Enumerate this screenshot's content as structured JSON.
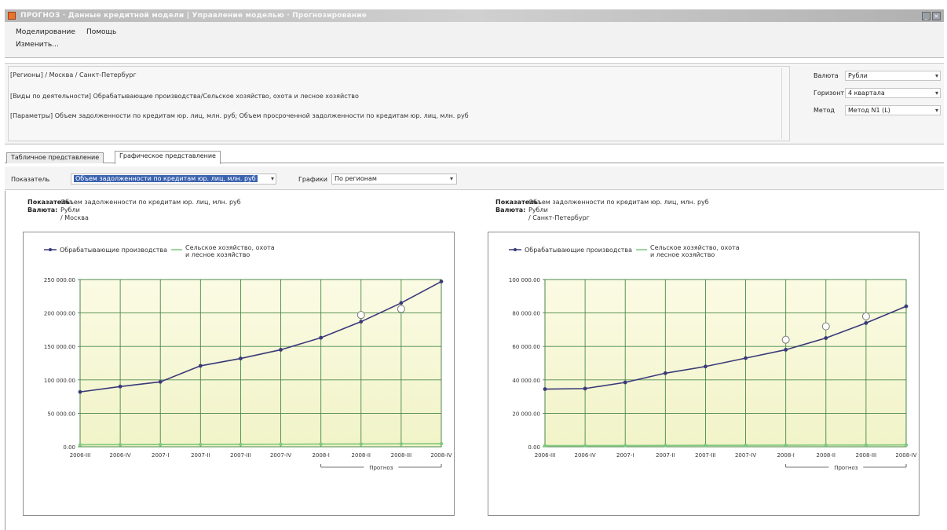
{
  "window": {
    "title": "ПРОГНОЗ · Данные кредитной модели | Управление моделью · Прогнозирование",
    "minimize_glyph": "_",
    "close_glyph": "×"
  },
  "menu": {
    "items": [
      "Моделирование",
      "Помощь"
    ],
    "toolbar_button": "Изменить..."
  },
  "params": {
    "lines": [
      "[Регионы]  / Москва / Санкт-Петербург",
      "[Виды по деятельности]  Обрабатывающие производства/Сельское хозяйство, охота и лесное хозяйство",
      "[Параметры]  Объем задолженности по кредитам юр. лиц, млн. руб; Объем просроченной задолженности по кредитам юр. лиц, млн. руб"
    ],
    "currency_label": "Валюта",
    "currency_value": "Рубли",
    "horizon_label": "Горизонт",
    "horizon_value": "4 квартала",
    "method_label": "Метод",
    "method_value": "Метод N1 (L)"
  },
  "tabs": [
    "Табличное представление",
    "Графическое представление"
  ],
  "active_tab": 1,
  "filter": {
    "indicator_label": "Показатель",
    "indicator_value": "Объем задолженности по кредитам юр. лиц, млн. руб",
    "charts_label": "Графики",
    "charts_value": "По регионам"
  },
  "panels": [
    {
      "indicator_key": "Показатель:",
      "indicator_value": "Объем задолженности по кредитам юр. лиц, млн. руб",
      "currency_key": "Валюта:",
      "currency_value": "Рубли",
      "region": "/ Москва",
      "legend": [
        "Обрабатывающие производства",
        "Сельское хозяйство, охота",
        "и лесное хозяйство"
      ],
      "forecast_label": "Прогноз"
    },
    {
      "indicator_key": "Показатель:",
      "indicator_value": "Объем задолженности по кредитам юр. лиц, млн. руб",
      "currency_key": "Валюта:",
      "currency_value": "Рубли",
      "region": "/ Санкт-Петербург",
      "legend": [
        "Обрабатывающие производства",
        "Сельское хозяйство, охота",
        "и лесное хозяйство"
      ],
      "forecast_label": "Прогноз"
    }
  ],
  "colors": {
    "line_manufacturing": "#3a3a7a",
    "line_agriculture": "#7ec87e",
    "plot_fill_top": "#fbfbe4",
    "plot_fill_bottom": "#f1f3c8",
    "grid": "#4a8a4a",
    "point_outline": "#7a7a7a"
  },
  "chart_data": [
    {
      "type": "line",
      "title": "",
      "categories": [
        "2006-III",
        "2006-IV",
        "2007-I",
        "2007-II",
        "2007-III",
        "2007-IV",
        "2008-I",
        "2008-II",
        "2008-III",
        "2008-IV"
      ],
      "ylim": [
        0,
        250000
      ],
      "yticks": [
        "0.00",
        "50 000.00",
        "100 000.00",
        "150 000.00",
        "200 000.00",
        "250 000.00"
      ],
      "grid": true,
      "legend_position": "top-left",
      "forecast_start_index": 6,
      "series": [
        {
          "name": "Обрабатывающие производства",
          "values": [
            82000,
            90000,
            97000,
            121000,
            132000,
            145000,
            163000,
            187000,
            215000,
            247000
          ]
        },
        {
          "name": "Сельское хозяйство, охота и лесное хозяйство",
          "values": [
            3000,
            3200,
            3300,
            3500,
            3600,
            3800,
            4000,
            4200,
            4400,
            4600
          ]
        }
      ],
      "outlier_points": [
        {
          "x": "2008-II",
          "y": 197000
        },
        {
          "x": "2008-III",
          "y": 206000
        }
      ]
    },
    {
      "type": "line",
      "title": "",
      "categories": [
        "2006-III",
        "2006-IV",
        "2007-I",
        "2007-II",
        "2007-III",
        "2007-IV",
        "2008-I",
        "2008-II",
        "2008-III",
        "2008-IV"
      ],
      "ylim": [
        0,
        100000
      ],
      "yticks": [
        "0.00",
        "20 000.00",
        "40 000.00",
        "60 000.00",
        "80 000.00",
        "100 000.00"
      ],
      "grid": true,
      "legend_position": "top-left",
      "forecast_start_index": 6,
      "series": [
        {
          "name": "Обрабатывающие производства",
          "values": [
            34500,
            34800,
            38500,
            44000,
            48000,
            53000,
            58000,
            65000,
            74000,
            84000
          ]
        },
        {
          "name": "Сельское хозяйство, охота и лесное хозяйство",
          "values": [
            700,
            700,
            750,
            800,
            850,
            900,
            950,
            1000,
            1050,
            1100
          ]
        }
      ],
      "outlier_points": [
        {
          "x": "2008-I",
          "y": 64000
        },
        {
          "x": "2008-II",
          "y": 72000
        },
        {
          "x": "2008-III",
          "y": 78000
        }
      ]
    }
  ]
}
